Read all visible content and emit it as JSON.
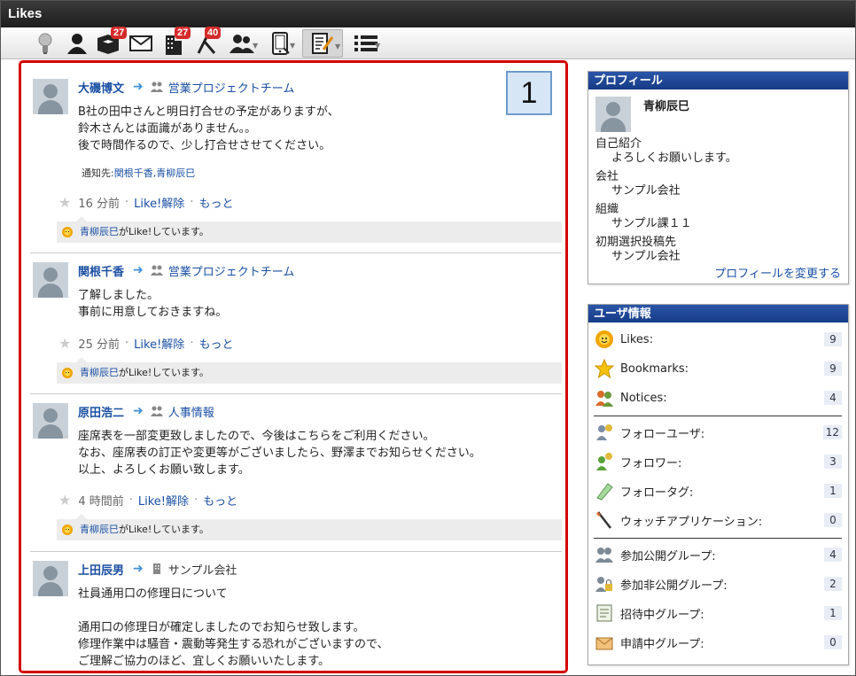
{
  "window": {
    "title": "Likes"
  },
  "toolbar": {
    "badges": {
      "apps": "27",
      "buildings": "27",
      "tools": "40"
    }
  },
  "feed": {
    "callout": "1",
    "posts": [
      {
        "author": "大磯博文",
        "group": "営業プロジェクトチーム",
        "text": "B社の田中さんと明日打合せの予定がありますが、\n鈴木さんとは面識がありません。。\n後で時間作るので、少し打合せさせてください。",
        "notify_label": "通知先:",
        "notify_names": "関根千香,青柳辰巳",
        "time": "16 分前",
        "unlike": "Like!解除",
        "more": "もっと",
        "liker": "青柳辰巳",
        "likes_suffix": "がLike!しています。"
      },
      {
        "author": "関根千香",
        "group": "営業プロジェクトチーム",
        "text": "了解しました。\n事前に用意しておきますね。",
        "time": "25 分前",
        "unlike": "Like!解除",
        "more": "もっと",
        "liker": "青柳辰巳",
        "likes_suffix": "がLike!しています。"
      },
      {
        "author": "原田浩二",
        "group": "人事情報",
        "text": "座席表を一部変更致しましたので、今後はこちらをご利用ください。\nなお、座席表の訂正や変更等がございましたら、野澤までお知らせください。\n以上、よろしくお願い致します。",
        "time": "4 時間前",
        "unlike": "Like!解除",
        "more": "もっと",
        "liker": "青柳辰巳",
        "likes_suffix": "がLike!しています。"
      },
      {
        "author": "上田辰男",
        "group": "サンプル会社",
        "text": "社員通用口の修理日について\n\n通用口の修理日が確定しましたのでお知らせ致します。\n修理作業中は騒音・震動等発生する恐れがございますので、\nご理解ご協力のほど、宜しくお願いいたします。"
      }
    ]
  },
  "profile": {
    "title": "プロフィール",
    "name": "青柳辰巳",
    "intro_label": "自己紹介",
    "intro": "よろしくお願いします。",
    "company_label": "会社",
    "company": "サンプル会社",
    "org_label": "組織",
    "org": "サンプル課１１",
    "default_post_label": "初期選択投稿先",
    "default_post": "サンプル会社",
    "edit_link": "プロフィールを変更する"
  },
  "userinfo": {
    "title": "ユーザ情報",
    "items": [
      {
        "label": "Likes:",
        "count": "9"
      },
      {
        "label": "Bookmarks:",
        "count": "9"
      },
      {
        "label": "Notices:",
        "count": "4"
      },
      {
        "label": "フォローユーザ:",
        "count": "12"
      },
      {
        "label": "フォロワー:",
        "count": "3"
      },
      {
        "label": "フォロータグ:",
        "count": "1"
      },
      {
        "label": "ウォッチアプリケーション:",
        "count": "0"
      },
      {
        "label": "参加公開グループ:",
        "count": "4"
      },
      {
        "label": "参加非公開グループ:",
        "count": "2"
      },
      {
        "label": "招待中グループ:",
        "count": "1"
      },
      {
        "label": "申請中グループ:",
        "count": "0"
      }
    ]
  },
  "colors": {
    "accent": "#d40000",
    "panel_header": "#1f479a",
    "link": "#1a4fa3",
    "badge": "#d42b2b"
  }
}
